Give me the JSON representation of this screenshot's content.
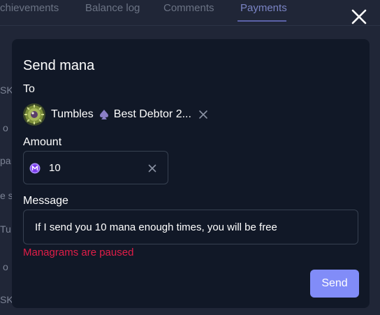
{
  "background": {
    "tabs": [
      "chievements",
      "Balance log",
      "Comments",
      "Payments"
    ],
    "active_tab": "Payments",
    "left_fragments": [
      "SK",
      "o",
      "pa",
      "e si",
      "Tu",
      "o",
      "SK"
    ]
  },
  "modal": {
    "title": "Send mana",
    "to_label": "To",
    "recipient": {
      "name": "Tumbles",
      "badge": "Best Debtor 2...",
      "avatar": "tumbles-avatar",
      "badge_icon": "spade-icon"
    },
    "amount_label": "Amount",
    "amount_value": "10",
    "amount_icon": "mana-coin-icon",
    "message_label": "Message",
    "message_value": "If I send you 10 mana enough times, you will be free",
    "error_text": "Managrams are paused",
    "send_label": "Send"
  },
  "colors": {
    "accent": "#818cf8",
    "error": "#e11d48",
    "modal_bg": "#111827",
    "overlay_bg": "#202637"
  }
}
